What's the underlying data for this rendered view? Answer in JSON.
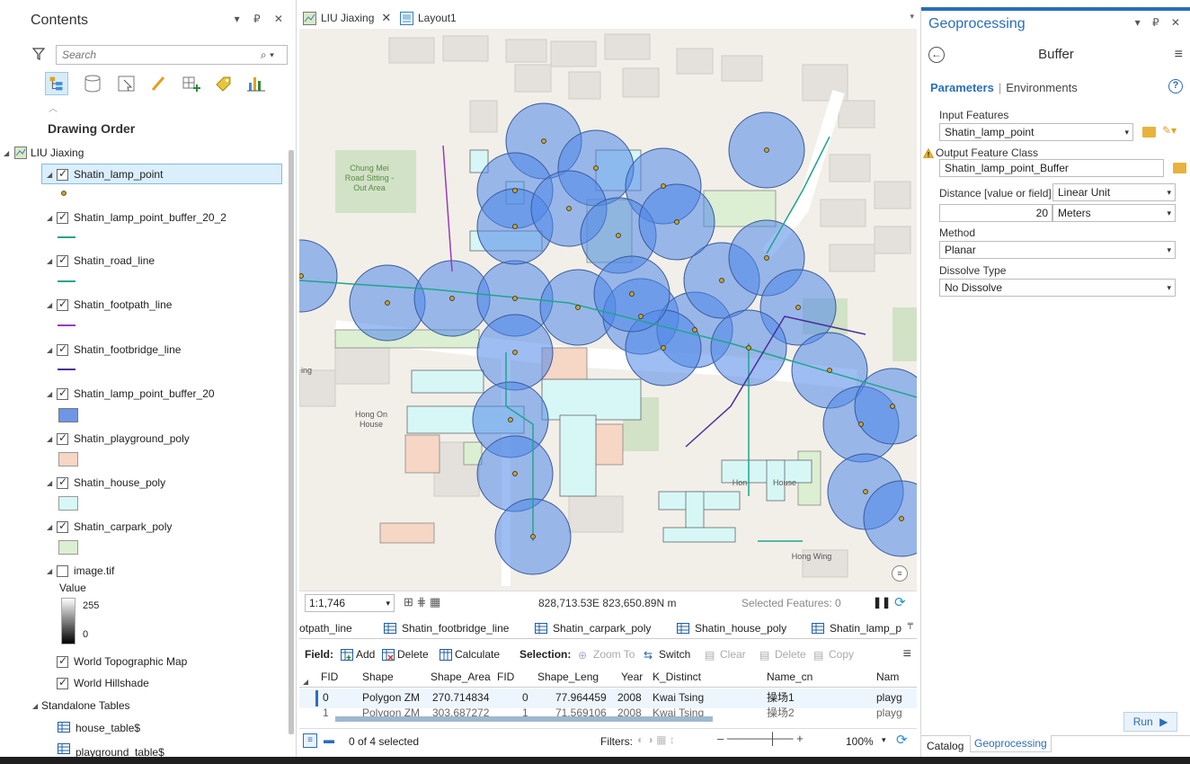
{
  "contents": {
    "title": "Contents",
    "pane_controls": "▾ ₽ ✕",
    "search_placeholder": "Search",
    "heading": "Drawing Order",
    "map_name": "LIU Jiaxing",
    "layers": [
      {
        "label": "Shatin_lamp_point",
        "checked": true
      },
      {
        "label": "Shatin_lamp_point_buffer_20_2",
        "checked": true
      },
      {
        "label": "Shatin_road_line",
        "checked": true
      },
      {
        "label": "Shatin_footpath_line",
        "checked": true
      },
      {
        "label": "Shatin_footbridge_line",
        "checked": true
      },
      {
        "label": "Shatin_lamp_point_buffer_20",
        "checked": true
      },
      {
        "label": "Shatin_playground_poly",
        "checked": true
      },
      {
        "label": "Shatin_house_poly",
        "checked": true
      },
      {
        "label": "Shatin_carpark_poly",
        "checked": true
      },
      {
        "label": "image.tif",
        "checked": false
      }
    ],
    "raster_value_label": "Value",
    "raster_max": "255",
    "raster_min": "0",
    "basemaps": [
      "World Topographic Map",
      "World Hillshade"
    ],
    "standalone_heading": "Standalone Tables",
    "tables": [
      "house_table$",
      "playground_table$"
    ]
  },
  "map_tabs": [
    {
      "label": "LIU Jiaxing",
      "closable": true
    },
    {
      "label": "Layout1",
      "closable": false
    }
  ],
  "map_labels": {
    "road_sitting": [
      "Chung Mei",
      "Road Sitting -",
      "Out Area"
    ],
    "hong_on": [
      "Hong On",
      "House"
    ],
    "hong_wing": "Hong Wing",
    "ing": "ing",
    "hon": "Hon",
    "house": "House"
  },
  "map_status": {
    "scale": "1:1,746",
    "coordinates": "828,713.53E 823,650.89N m",
    "selected_features": "Selected Features: 0"
  },
  "table_tabs": [
    "otpath_line",
    "Shatin_footbridge_line",
    "Shatin_carpark_poly",
    "Shatin_house_poly",
    "Shatin_lamp_p"
  ],
  "table_toolbar": {
    "field_label": "Field:",
    "add": "Add",
    "delete": "Delete",
    "calculate": "Calculate",
    "selection_label": "Selection:",
    "zoom_to": "Zoom To",
    "switch": "Switch",
    "clear": "Clear",
    "delete2": "Delete",
    "copy": "Copy"
  },
  "table": {
    "columns": [
      "FID",
      "Shape",
      "Shape_Area",
      "FID",
      "Shape_Leng",
      "Year",
      "K_Distinct",
      "Name_cn",
      "Nam"
    ],
    "rows": [
      [
        "0",
        "Polygon ZM",
        "270.714834",
        "0",
        "77.964459",
        "2008",
        "Kwai Tsing",
        "操场1",
        "playg"
      ],
      [
        "1",
        "Polygon ZM",
        "303.687272",
        "1",
        "71.569106",
        "2008",
        "Kwai Tsing",
        "操场2",
        "playg"
      ]
    ]
  },
  "table_status": {
    "selected": "0 of 4 selected",
    "filters_label": "Filters:",
    "zoom": "100%"
  },
  "geoprocessing": {
    "title": "Geoprocessing",
    "pane_controls": "▾ ₽ ✕",
    "tool": "Buffer",
    "tab_parameters": "Parameters",
    "tab_environments": "Environments",
    "input_features_label": "Input Features",
    "input_features_value": "Shatin_lamp_point",
    "output_label": "Output Feature Class",
    "output_value": "Shatin_lamp_point_Buffer",
    "distance_label": "Distance [value or field]",
    "distance_type": "Linear Unit",
    "distance_value": "20",
    "distance_unit": "Meters",
    "method_label": "Method",
    "method_value": "Planar",
    "dissolve_label": "Dissolve Type",
    "dissolve_value": "No Dissolve",
    "run_label": "Run",
    "bottom_tabs": [
      "Catalog",
      "Geoprocessing"
    ]
  },
  "colors": {
    "accent": "#2a6ebb",
    "buffer_fill": "#4f87e8",
    "house_fill": "#d7f7f7",
    "playground_fill": "#f6d6c4",
    "carpark_fill": "#dcefd2",
    "road_line": "#1fa58a",
    "footpath_line": "#9b3bb5",
    "footbridge_line": "#4a2f9c"
  }
}
